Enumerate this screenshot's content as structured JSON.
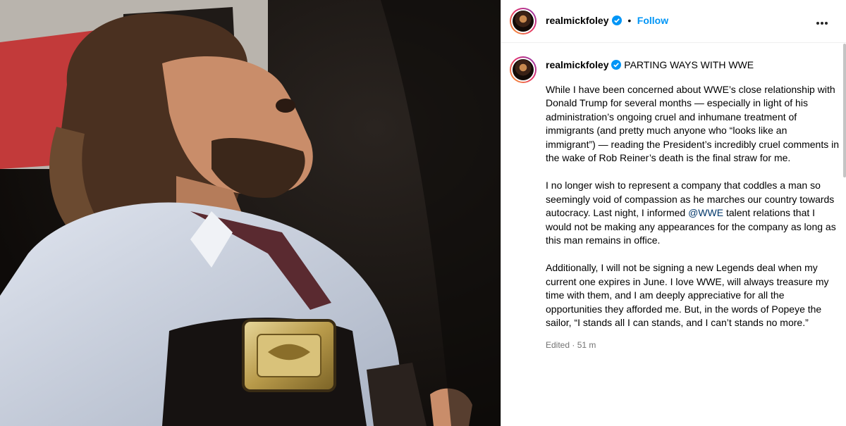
{
  "post": {
    "username": "realmickfoley",
    "follow_label": "Follow",
    "separator": "•",
    "caption_title": "PARTING WAYS WITH WWE",
    "caption_p1": "While I have been concerned about WWE’s close relationship with Donald Trump for several months — especially in light of his administration’s ongoing cruel and inhumane treatment of immigrants (and pretty much anyone who “looks like an immigrant”) — reading the President’s incredibly cruel comments in the wake of Rob Reiner’s death is the final straw for me.",
    "caption_p2_a": "I no longer wish to represent a company that coddles a man so seemingly void of compassion as he marches our country towards autocracy. Last night, I informed ",
    "caption_p2_mention": "@WWE",
    "caption_p2_b": " talent relations that I would not be making any appearances for the company as long as this man remains in office.",
    "caption_p3": "Additionally, I will not be signing a new Legends deal when my current one expires in June. I love WWE, will always treasure my time with them, and I am deeply appreciative for all the opportunities they afforded me. But, in the words of Popeye the sailor, “I stands all I can stands, and I can’t stands no more.”",
    "edited": "Edited · 51 m"
  },
  "icons": {
    "verified": "verified-badge-icon",
    "more": "more-options-icon"
  },
  "colors": {
    "accent": "#0095f6",
    "verified": "#0095f6",
    "mention": "#00376b",
    "muted": "#737373"
  }
}
